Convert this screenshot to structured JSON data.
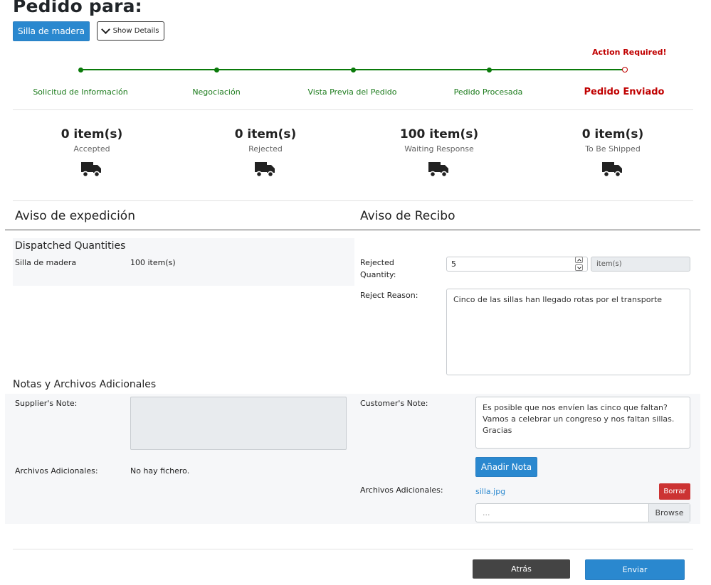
{
  "header": {
    "title": "Pedido para:",
    "product_button": "Silla de madera",
    "show_details": "Show Details"
  },
  "timeline": {
    "action_required": "Action Required!",
    "steps": [
      {
        "label": "Solicitud de Información",
        "state": "done"
      },
      {
        "label": "Negociación",
        "state": "done"
      },
      {
        "label": "Vista Previa del Pedido",
        "state": "done"
      },
      {
        "label": "Pedido Procesada",
        "state": "done"
      },
      {
        "label": "Pedido Enviado",
        "state": "active"
      }
    ],
    "colors": {
      "done": "#0a7a0a",
      "active": "#c00000"
    }
  },
  "stats": [
    {
      "count": "0 item(s)",
      "label": "Accepted",
      "icon": "truck-icon"
    },
    {
      "count": "0 item(s)",
      "label": "Rejected",
      "icon": "truck-icon"
    },
    {
      "count": "100 item(s)",
      "label": "Waiting Response",
      "icon": "truck-icon"
    },
    {
      "count": "0 item(s)",
      "label": "To Be Shipped",
      "icon": "truck-icon"
    }
  ],
  "dispatch": {
    "title": "Aviso de expedición",
    "subtitle": "Dispatched Quantities",
    "product": "Silla de madera",
    "quantity": "100 item(s)"
  },
  "receipt": {
    "title": "Aviso de Recibo",
    "rejected_label": "Rejected Quantity:",
    "rejected_value": "5",
    "rejected_unit": "item(s)",
    "reason_label": "Reject Reason:",
    "reason_value": "Cinco de las sillas han llegado rotas por el transporte"
  },
  "notes": {
    "title": "Notas y Archivos Adicionales",
    "supplier_note_label": "Supplier's Note:",
    "supplier_files_label": "Archivos Adicionales:",
    "supplier_files_value": "No hay fichero.",
    "customer_note_label": "Customer's Note:",
    "customer_note_value": "Es posible que nos envíen las cinco que faltan?\nVamos a celebrar un congreso y nos faltan sillas.\nGracias",
    "add_note_button": "Añadir Nota",
    "customer_files_label": "Archivos Adicionales:",
    "file_name": "silla.jpg",
    "delete_button": "Borrar",
    "file_placeholder": "...",
    "browse_button": "Browse"
  },
  "footer": {
    "back_button": "Atrás",
    "send_button": "Enviar"
  },
  "colors": {
    "primary": "#2a88cf",
    "danger": "#cc3333",
    "dark": "#444444"
  }
}
